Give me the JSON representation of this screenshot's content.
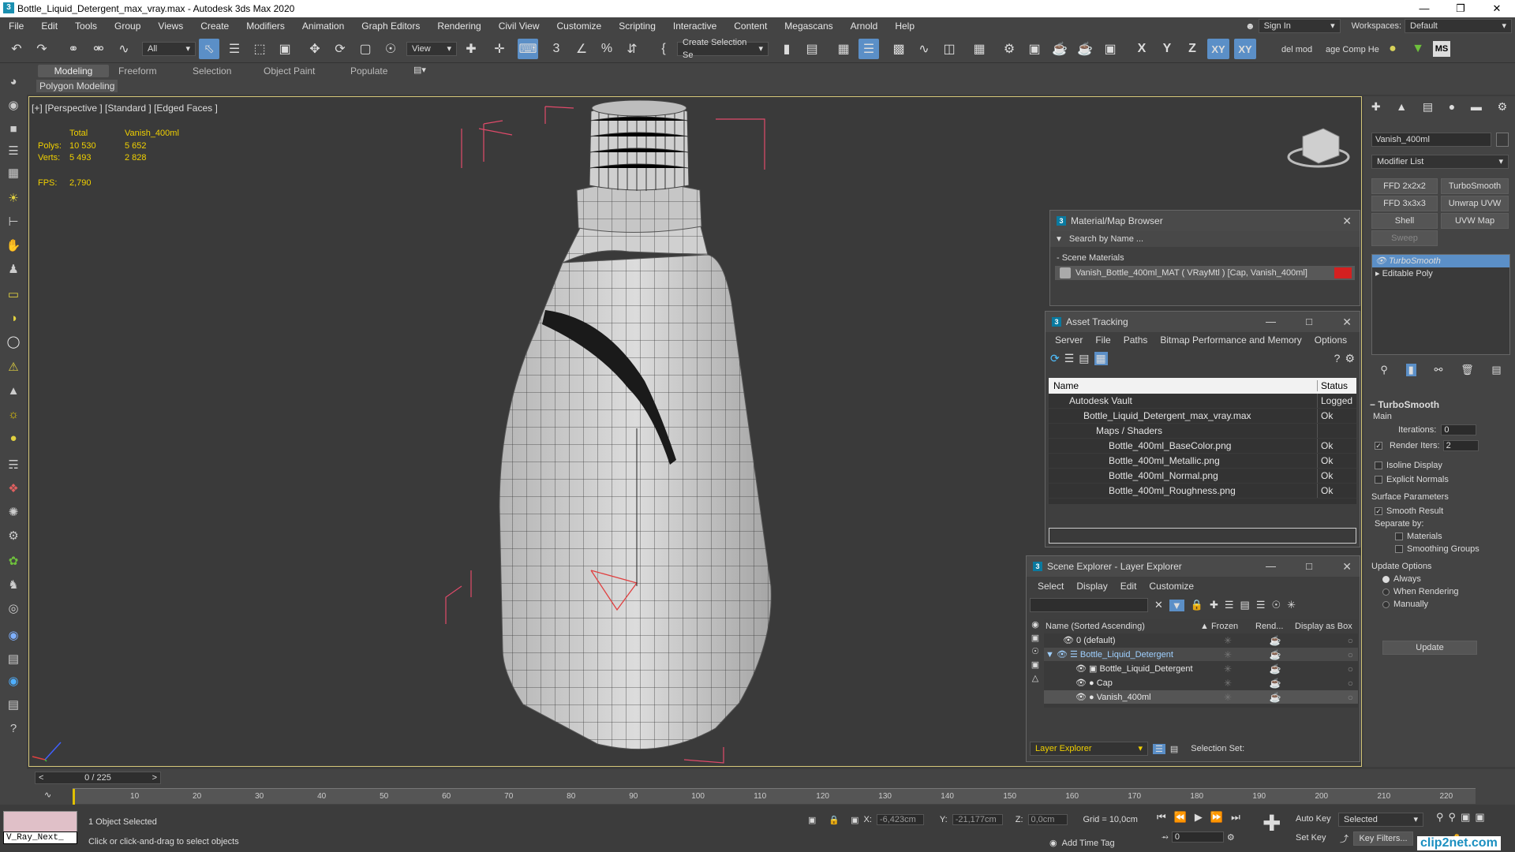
{
  "window": {
    "title": "Bottle_Liquid_Detergent_max_vray.max - Autodesk 3ds Max 2020",
    "logo": "3"
  },
  "menu": [
    "File",
    "Edit",
    "Tools",
    "Group",
    "Views",
    "Create",
    "Modifiers",
    "Animation",
    "Graph Editors",
    "Rendering",
    "Civil View",
    "Customize",
    "Scripting",
    "Interactive",
    "Content",
    "Megascans",
    "Arnold",
    "Help"
  ],
  "account": {
    "sign_in": "Sign In",
    "workspaces_label": "Workspaces:",
    "workspace": "Default"
  },
  "toolbar": {
    "filter": "All",
    "refcoord": "View",
    "selset": "Create Selection Se",
    "axis_x": "X",
    "axis_y": "Y",
    "axis_z": "Z",
    "axis_xy": "XY",
    "axis_xyz": "XY",
    "script1": "del mod",
    "script2": "age Comp Help",
    "ms": "MS"
  },
  "ribbon": {
    "tabs": [
      "Modeling",
      "Freeform",
      "Selection",
      "Object Paint",
      "Populate"
    ],
    "sub": "Polygon Modeling"
  },
  "viewport": {
    "label": "[+] [Perspective ] [Standard ] [Edged Faces ]",
    "stats": {
      "h_total": "Total",
      "h_obj": "Vanish_400ml",
      "polys_label": "Polys:",
      "polys_total": "10 530",
      "polys_obj": "5 652",
      "verts_label": "Verts:",
      "verts_total": "5 493",
      "verts_obj": "2 828",
      "fps_label": "FPS:",
      "fps": "2,790"
    }
  },
  "matbrowser": {
    "title": "Material/Map Browser",
    "search": "Search by Name ...",
    "section": "- Scene Materials",
    "material": "Vanish_Bottle_400ml_MAT  ( VRayMtl ) [Cap, Vanish_400ml]"
  },
  "asset": {
    "title": "Asset Tracking",
    "menu": [
      "Server",
      "File",
      "Paths",
      "Bitmap Performance and Memory",
      "Options"
    ],
    "h_name": "Name",
    "h_status": "Status",
    "rows": [
      {
        "name": "Autodesk Vault",
        "status": "Logged"
      },
      {
        "name": "Bottle_Liquid_Detergent_max_vray.max",
        "status": "Ok"
      },
      {
        "name": "Maps / Shaders",
        "status": ""
      },
      {
        "name": "Bottle_400ml_BaseColor.png",
        "status": "Ok"
      },
      {
        "name": "Bottle_400ml_Metallic.png",
        "status": "Ok"
      },
      {
        "name": "Bottle_400ml_Normal.png",
        "status": "Ok"
      },
      {
        "name": "Bottle_400ml_Roughness.png",
        "status": "Ok"
      }
    ]
  },
  "scene": {
    "title": "Scene Explorer - Layer Explorer",
    "menu": [
      "Select",
      "Display",
      "Edit",
      "Customize"
    ],
    "h_name": "Name (Sorted Ascending)",
    "h_frozen": "▲ Frozen",
    "h_render": "Rend...",
    "h_box": "Display as Box",
    "rows": [
      {
        "name": "0 (default)"
      },
      {
        "name": "Bottle_Liquid_Detergent"
      },
      {
        "name": "Bottle_Liquid_Detergent"
      },
      {
        "name": "Cap"
      },
      {
        "name": "Vanish_400ml"
      }
    ],
    "footer": "Layer Explorer",
    "selset": "Selection Set:"
  },
  "cmd": {
    "objname": "Vanish_400ml",
    "modlist": "Modifier List",
    "btns": [
      "FFD 2x2x2",
      "TurboSmooth",
      "FFD 3x3x3",
      "Unwrap UVW",
      "Shell",
      "UVW Map",
      "Sweep"
    ],
    "stack": [
      "TurboSmooth",
      "Editable Poly"
    ],
    "ts": {
      "title": "TurboSmooth",
      "main": "Main",
      "iter_label": "Iterations:",
      "iter": "0",
      "render_label": "Render Iters:",
      "render": "2",
      "isoline": "Isoline Display",
      "explicit": "Explicit Normals",
      "surface": "Surface Parameters",
      "smooth": "Smooth Result",
      "separate": "Separate by:",
      "materials": "Materials",
      "groups": "Smoothing Groups",
      "update_opts": "Update Options",
      "always": "Always",
      "when": "When Rendering",
      "manually": "Manually",
      "update": "Update"
    }
  },
  "timeline": {
    "frame": "0 / 225",
    "ticks": [
      "10",
      "20",
      "30",
      "40",
      "50",
      "60",
      "70",
      "80",
      "90",
      "100",
      "110",
      "120",
      "130",
      "140",
      "150",
      "160",
      "170",
      "180",
      "190",
      "200",
      "210",
      "220"
    ]
  },
  "status": {
    "script": "V_Ray_Next_",
    "selected": "1 Object Selected",
    "hint": "Click or click-and-drag to select objects",
    "x_label": "X:",
    "x": "-6,423cm",
    "y_label": "Y:",
    "y": "-21,177cm",
    "z_label": "Z:",
    "z": "0,0cm",
    "grid": "Grid = 10,0cm",
    "addtime": "Add Time Tag",
    "autokey": "Auto Key",
    "setkey": "Set Key",
    "selmode": "Selected",
    "keyfilters": "Key Filters...",
    "frame": "0",
    "watermark": "clip2net.com"
  }
}
